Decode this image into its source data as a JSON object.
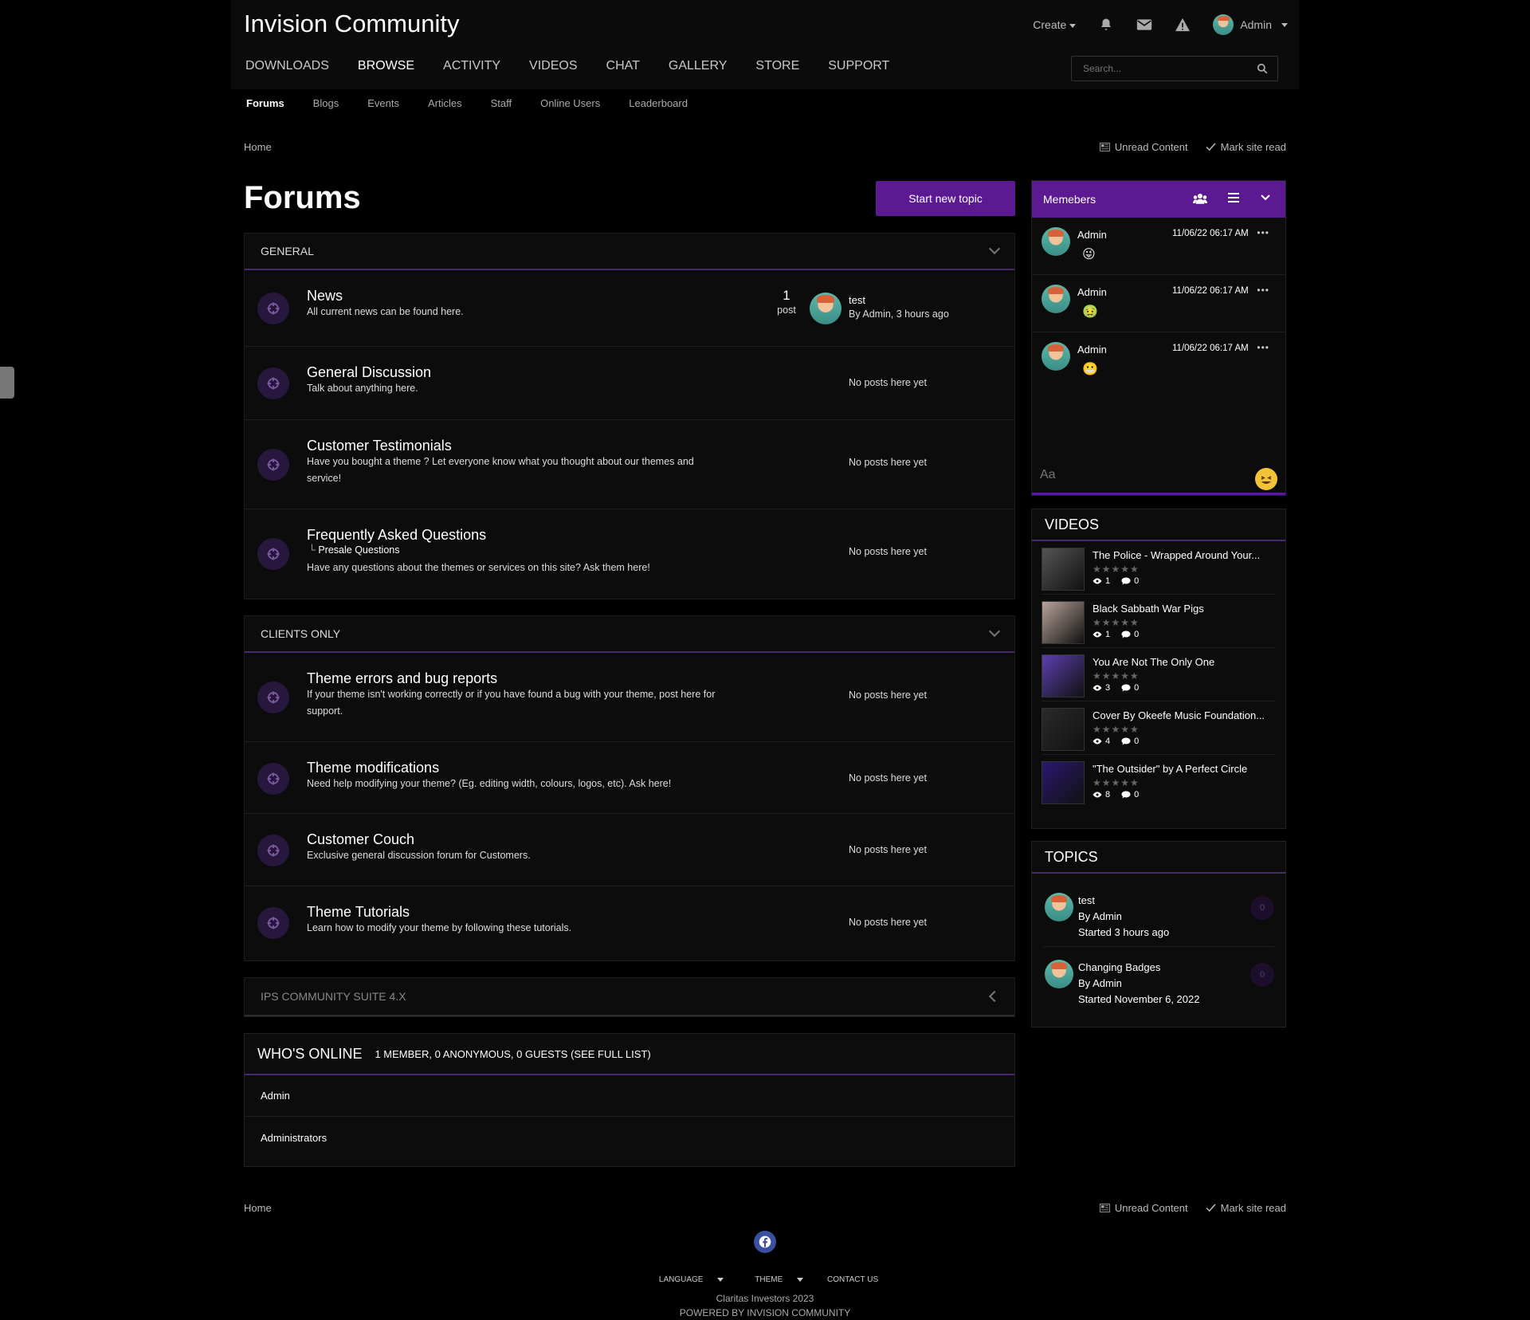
{
  "header": {
    "brand": "Invision Community",
    "create_label": "Create",
    "user_name": "Admin",
    "nav": [
      "DOWNLOADS",
      "BROWSE",
      "ACTIVITY",
      "VIDEOS",
      "CHAT",
      "GALLERY",
      "STORE",
      "SUPPORT"
    ],
    "search_placeholder": "Search..."
  },
  "subnav": [
    "Forums",
    "Blogs",
    "Events",
    "Articles",
    "Staff",
    "Online Users",
    "Leaderboard"
  ],
  "breadcrumb": {
    "home": "Home",
    "unread": "Unread Content",
    "mark_read": "Mark site read"
  },
  "page": {
    "title": "Forums",
    "new_topic": "Start new topic"
  },
  "categories": [
    {
      "name": "GENERAL",
      "forums": [
        {
          "title": "News",
          "desc": "All current news can be found here.",
          "count": "1",
          "count_label": "post",
          "last_title": "test",
          "last_by": "By Admin, 3 hours ago"
        },
        {
          "title": "General Discussion",
          "desc": "Talk about anything here.",
          "status": "No posts here yet"
        },
        {
          "title": "Customer Testimonials",
          "desc": "Have you bought a theme ? Let everyone know what you thought about our themes and service!",
          "status": "No posts here yet"
        },
        {
          "title": "Frequently Asked Questions",
          "sub": "Presale Questions",
          "desc": "Have any questions about the themes or services on this site? Ask them here!",
          "status": "No posts here yet"
        }
      ]
    },
    {
      "name": "CLIENTS ONLY",
      "forums": [
        {
          "title": "Theme errors and bug reports",
          "desc": "If your theme isn't working correctly or if you have found a bug with your theme, post here for support.",
          "status": "No posts here yet"
        },
        {
          "title": "Theme modifications",
          "desc": "Need help modifying your theme? (Eg. editing width, colours, logos, etc). Ask here!",
          "status": "No posts here yet"
        },
        {
          "title": "Customer Couch",
          "desc": "Exclusive general discussion forum for Customers.",
          "status": "No posts here yet"
        },
        {
          "title": "Theme Tutorials",
          "desc": "Learn how to modify your theme by following these tutorials.",
          "status": "No posts here yet"
        }
      ]
    },
    {
      "name": "IPS COMMUNITY SUITE 4.X"
    }
  ],
  "online": {
    "title": "WHO'S ONLINE",
    "summary": "1 MEMBER, 0 ANONYMOUS, 0 GUESTS (SEE FULL LIST)",
    "members": [
      "Admin",
      "Administrators"
    ]
  },
  "chat": {
    "title": "Memebers",
    "messages": [
      {
        "name": "Admin",
        "time": "11/06/22 06:17 AM",
        "emoji": "😜"
      },
      {
        "name": "Admin",
        "time": "11/06/22 06:17 AM",
        "emoji": "🤢"
      },
      {
        "name": "Admin",
        "time": "11/06/22 06:17 AM",
        "emoji": "😬"
      }
    ],
    "input_placeholder": "Aa"
  },
  "videos": {
    "title": "VIDEOS",
    "items": [
      {
        "title": "The Police - Wrapped Around Your...",
        "views": "1",
        "comments": "0",
        "color": "#555"
      },
      {
        "title": "Black Sabbath War Pigs",
        "views": "1",
        "comments": "0",
        "color": "#b7a39a"
      },
      {
        "title": "You Are Not The Only One",
        "views": "3",
        "comments": "0",
        "color": "#5b3fb0"
      },
      {
        "title": "Cover By Okeefe Music Foundation...",
        "views": "4",
        "comments": "0",
        "color": "#2b2b2b"
      },
      {
        "title": "\"The Outsider\" by A Perfect Circle",
        "views": "8",
        "comments": "0",
        "color": "#2a1870"
      }
    ]
  },
  "topics": {
    "title": "TOPICS",
    "items": [
      {
        "title": "test",
        "by": "By Admin",
        "started": "Started 3 hours ago",
        "count": "0"
      },
      {
        "title": "Changing Badges",
        "by": "By Admin",
        "started": "Started November 6, 2022",
        "count": "0"
      }
    ]
  },
  "footer": {
    "home": "Home",
    "unread": "Unread Content",
    "mark_read": "Mark site read",
    "links": [
      "LANGUAGE",
      "THEME",
      "CONTACT US"
    ],
    "copyright": "Claritas Investors 2023",
    "powered": "POWERED BY INVISION COMMUNITY"
  }
}
